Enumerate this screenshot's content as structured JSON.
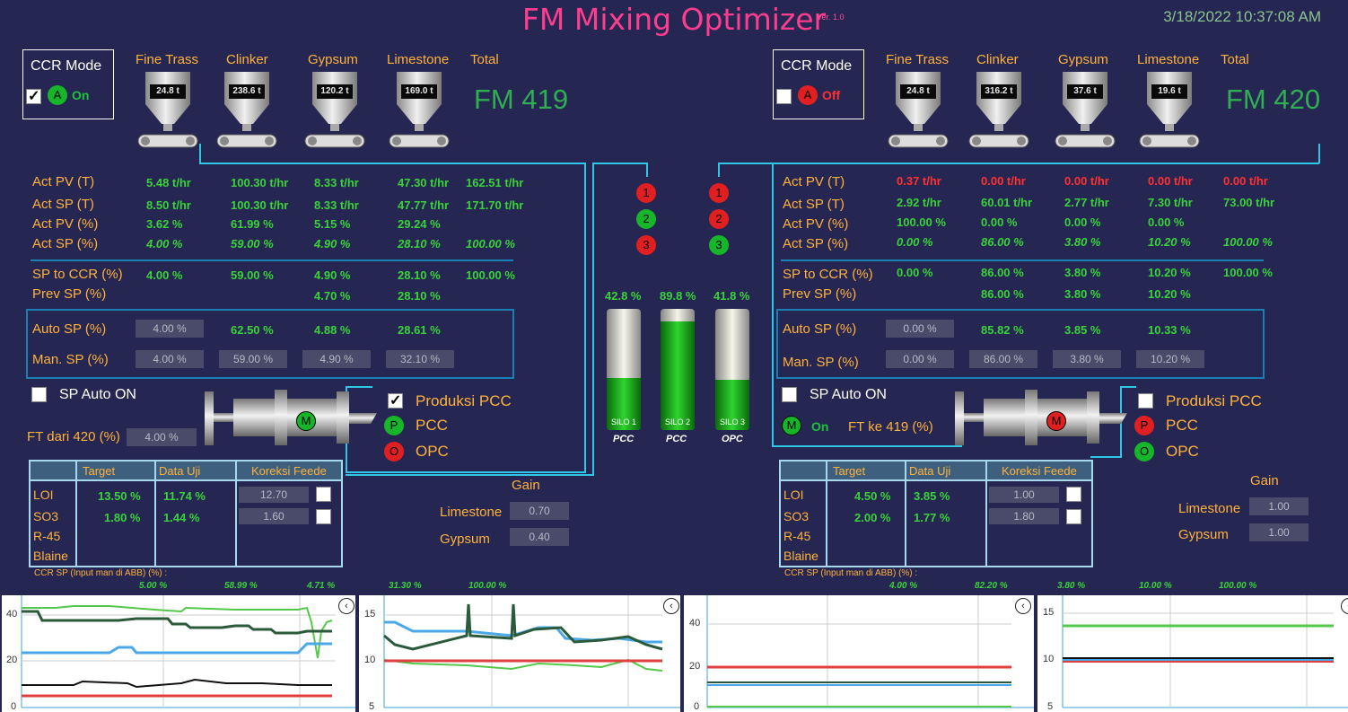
{
  "header": {
    "title": "FM Mixing Optimizer",
    "version": "Ver. 1.0",
    "datetime": "3/18/2022 10:37:08 AM"
  },
  "materials": [
    "Fine Trass",
    "Clinker",
    "Gypsum",
    "Limestone"
  ],
  "total_label": "Total",
  "row_labels": {
    "act_pv_t": "Act PV (T)",
    "act_sp_t": "Act SP (T)",
    "act_pv_pct": "Act PV (%)",
    "act_sp_pct": "Act SP (%)",
    "sp_to_ccr": "SP to CCR (%)",
    "prev_sp": "Prev SP (%)",
    "auto_sp": "Auto SP (%)",
    "man_sp": "Man. SP (%)"
  },
  "ccr_mode_label": "CCR Mode",
  "sp_auto_on": "SP Auto ON",
  "produksi_pcc": "Produksi PCC",
  "pcc": "PCC",
  "opc": "OPC",
  "gain": "Gain",
  "limestone": "Limestone",
  "gypsum": "Gypsum",
  "table_headers": [
    "Target",
    "Data Uji",
    "Koreksi Feede"
  ],
  "table_rows": [
    "LOI",
    "SO3",
    "R-45",
    "Blaine"
  ],
  "ccr_sp_label": "CCR SP (Input man di ABB) (%) :",
  "left": {
    "ccr_on": true,
    "mode_letter": "A",
    "mode_status": "On",
    "fm_name": "FM 419",
    "hoppers": [
      "24.8 t",
      "238.6 t",
      "120.2 t",
      "169.0 t"
    ],
    "act_pv_t": [
      "5.48 t/hr",
      "100.30 t/hr",
      "8.33 t/hr",
      "47.30 t/hr",
      "162.51 t/hr"
    ],
    "act_sp_t": [
      "8.50 t/hr",
      "100.30 t/hr",
      "8.33 t/hr",
      "47.77 t/hr",
      "171.70 t/hr"
    ],
    "act_pv_pct": [
      "3.62 %",
      "61.99 %",
      "5.15 %",
      "29.24 %"
    ],
    "act_sp_pct": [
      "4.00 %",
      "59.00 %",
      "4.90 %",
      "28.10 %",
      "100.00 %"
    ],
    "sp_to_ccr": [
      "4.00 %",
      "59.00 %",
      "4.90 %",
      "28.10 %",
      "100.00 %"
    ],
    "prev_sp": [
      "",
      "",
      "4.70 %",
      "28.10 %"
    ],
    "auto_sp": [
      "4.00 %",
      "62.50 %",
      "4.88 %",
      "28.61 %"
    ],
    "man_sp": [
      "4.00 %",
      "59.00 %",
      "4.90 %",
      "32.10 %"
    ],
    "ft_label": "FT dari 420 (%)",
    "ft_value": "4.00 %",
    "motor_letter": "M",
    "produksi_pcc_checked": true,
    "p_letter": "P",
    "o_letter": "O",
    "loi": [
      "13.50 %",
      "11.74 %",
      "12.70"
    ],
    "so3": [
      "1.80 %",
      "1.44 %",
      "1.60"
    ],
    "gain_limestone": "0.70",
    "gain_gypsum": "0.40",
    "ccr_sp": [
      "5.00 %",
      "58.99 %",
      "4.71 %",
      "31.30 %",
      "100.00 %"
    ]
  },
  "right": {
    "ccr_on": false,
    "mode_letter": "A",
    "mode_status": "Off",
    "fm_name": "FM 420",
    "hoppers": [
      "24.8 t",
      "316.2 t",
      "37.6 t",
      "19.6 t"
    ],
    "act_pv_t": [
      "0.37 t/hr",
      "0.00 t/hr",
      "0.00 t/hr",
      "0.00 t/hr",
      "0.00 t/hr"
    ],
    "act_sp_t": [
      "2.92 t/hr",
      "60.01 t/hr",
      "2.77 t/hr",
      "7.30 t/hr",
      "73.00 t/hr"
    ],
    "act_pv_pct": [
      "100.00 %",
      "0.00 %",
      "0.00 %",
      "0.00 %"
    ],
    "act_sp_pct": [
      "0.00 %",
      "86.00 %",
      "3.80 %",
      "10.20 %",
      "100.00 %"
    ],
    "sp_to_ccr": [
      "0.00 %",
      "86.00 %",
      "3.80 %",
      "10.20 %",
      "100.00 %"
    ],
    "prev_sp": [
      "",
      "86.00 %",
      "3.80 %",
      "10.20 %"
    ],
    "auto_sp": [
      "0.00 %",
      "85.82 %",
      "3.85 %",
      "10.33 %"
    ],
    "man_sp": [
      "0.00 %",
      "86.00 %",
      "3.80 %",
      "10.20 %"
    ],
    "ft_label": "FT ke 419 (%)",
    "m_letter": "M",
    "m_status": "On",
    "motor_letter": "M",
    "produksi_pcc_checked": false,
    "p_letter": "P",
    "o_letter": "O",
    "loi": [
      "4.50 %",
      "3.85 %",
      "1.00"
    ],
    "so3": [
      "2.00 %",
      "1.77 %",
      "1.80"
    ],
    "gain_limestone": "1.00",
    "gain_gypsum": "1.00",
    "ccr_sp": [
      "4.00 %",
      "82.20 %",
      "3.80 %",
      "10.00 %",
      "100.00 %"
    ]
  },
  "routing": {
    "left": [
      "1",
      "2",
      "3"
    ],
    "right": [
      "1",
      "2",
      "3"
    ],
    "left_colors": [
      "#e02020",
      "#16b52a",
      "#e02020"
    ],
    "right_colors": [
      "#e02020",
      "#e02020",
      "#16b52a"
    ]
  },
  "silos": [
    {
      "pct": "42.8 %",
      "label": "SILO 1",
      "type": "PCC",
      "level": 0.428
    },
    {
      "pct": "89.8 %",
      "label": "SILO 2",
      "type": "PCC",
      "level": 0.898
    },
    {
      "pct": "41.8 %",
      "label": "SILO 3",
      "type": "OPC",
      "level": 0.418
    }
  ],
  "trends": [
    {
      "ticks": [
        "40",
        "20",
        "0"
      ]
    },
    {
      "ticks": [
        "15",
        "10",
        "5"
      ]
    },
    {
      "ticks": [
        "40",
        "20",
        "0"
      ]
    },
    {
      "ticks": [
        "15",
        "10",
        "5"
      ]
    }
  ],
  "close_glyph": "‹"
}
